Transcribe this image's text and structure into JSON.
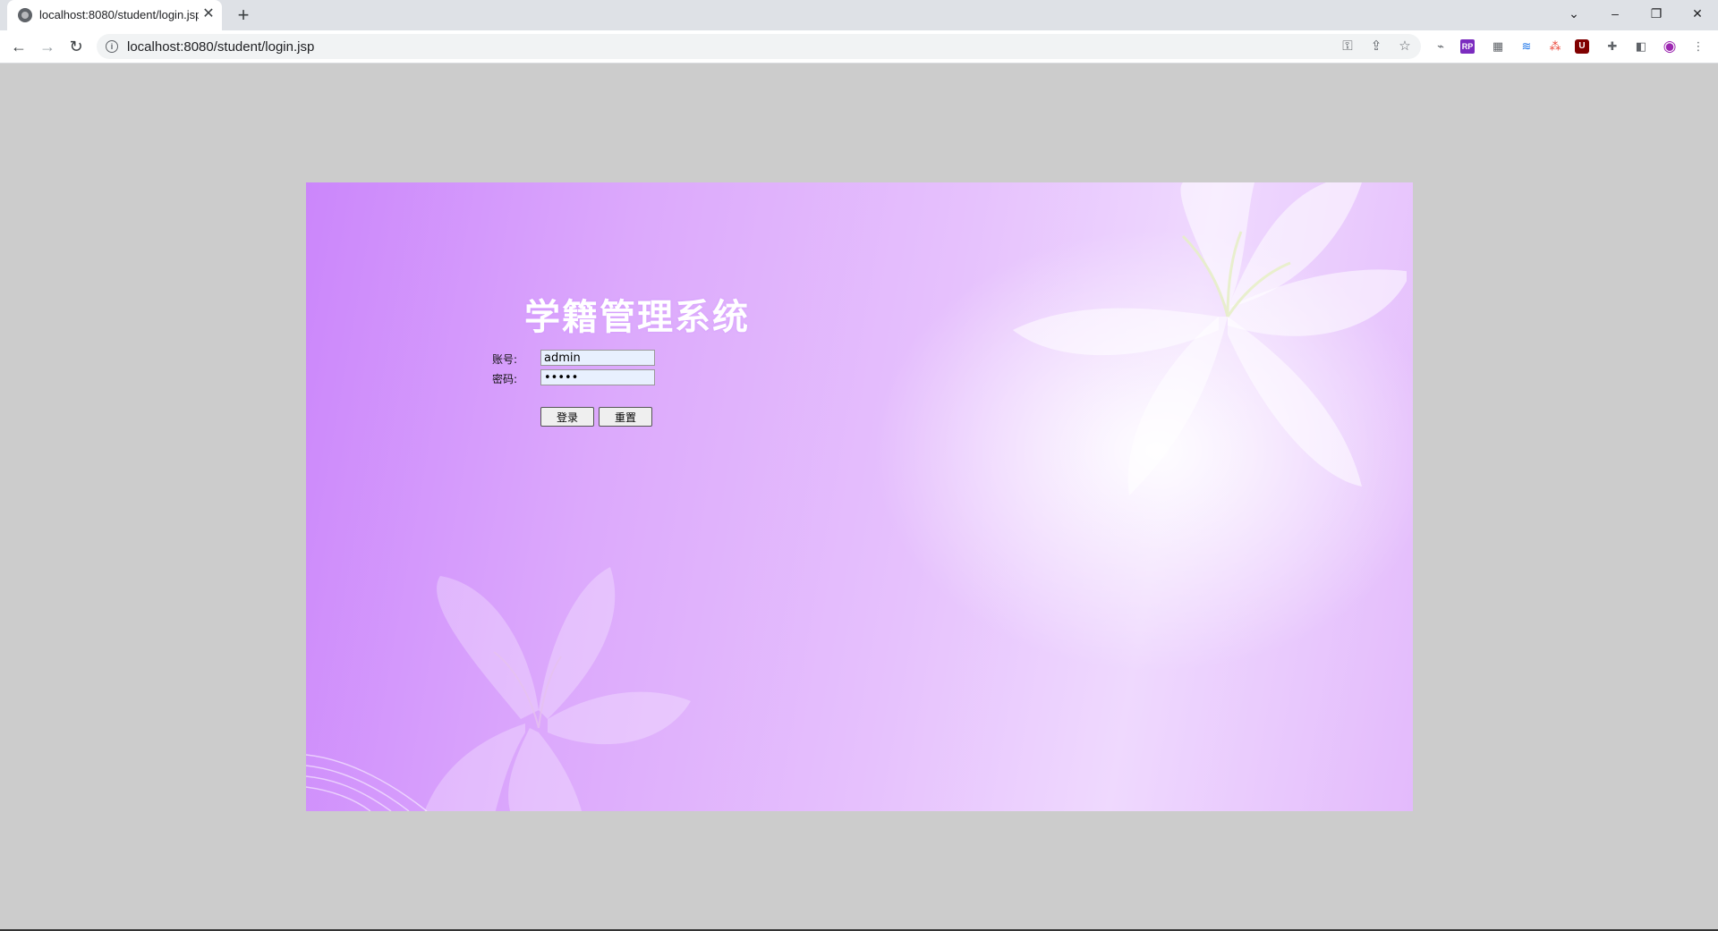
{
  "browser": {
    "tab_title": "localhost:8080/student/login.jsp",
    "tab_close": "✕",
    "new_tab": "+",
    "url": "localhost:8080/student/login.jsp",
    "window_controls": {
      "tabsearch": "⌄",
      "minimize": "–",
      "restore": "❐",
      "close": "✕"
    },
    "nav": {
      "back": "←",
      "forward": "→",
      "reload": "↻"
    },
    "info_icon": "i",
    "omnibox_icons": {
      "key": "⚿",
      "share": "⇪",
      "star": "☆"
    },
    "extensions": [
      "⌁",
      "RP",
      "▦",
      "≋",
      "⁂",
      "U",
      "✚",
      "◧",
      "◉",
      "⋮"
    ]
  },
  "login": {
    "title": "学籍管理系统",
    "account_label": "账号:",
    "account_value": "admin",
    "password_label": "密码:",
    "password_value": "admin",
    "login_button": "登录",
    "reset_button": "重置"
  },
  "colors": {
    "page_background": "#cccccc",
    "panel_gradient_start": "#cb86fb",
    "panel_gradient_end": "#efd9fe",
    "title_color": "#ffffff"
  }
}
